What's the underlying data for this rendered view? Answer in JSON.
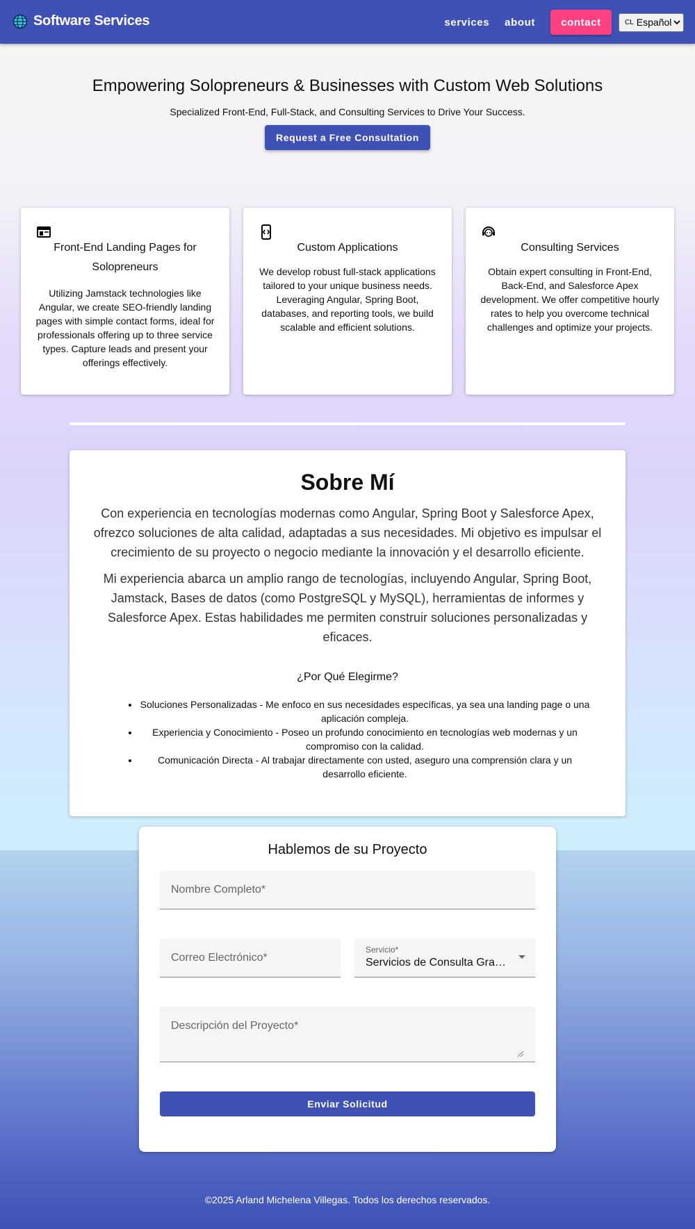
{
  "header": {
    "brand": "Software Services",
    "brand_icon": "globe-icon",
    "nav": {
      "services": "services",
      "about": "about",
      "contact": "contact"
    },
    "language": {
      "code": "CL",
      "selected": "Español"
    }
  },
  "hero": {
    "title": "Empowering Solopreneurs & Businesses with Custom Web Solutions",
    "subtitle": "Specialized Front-End, Full-Stack, and Consulting Services to Drive Your Success.",
    "cta": "Request a Free Consultation"
  },
  "services": [
    {
      "icon": "web-page-icon",
      "title": "Front-End Landing Pages for Solopreneurs",
      "text": "Utilizing Jamstack technologies like Angular, we create SEO-friendly landing pages with simple contact forms, ideal for professionals offering up to three service types. Capture leads and present your offerings effectively."
    },
    {
      "icon": "phone-code-icon",
      "title": "Custom Applications",
      "text": "We develop robust full-stack applications tailored to your unique business needs. Leveraging Angular, Spring Boot, databases, and reporting tools, we build scalable and efficient solutions."
    },
    {
      "icon": "support-agent-icon",
      "title": "Consulting Services",
      "text": "Obtain expert consulting in Front-End, Back-End, and Salesforce Apex development. We offer competitive hourly rates to help you overcome technical challenges and optimize your projects."
    }
  ],
  "about": {
    "title": "Sobre Mí",
    "p1": "Con experiencia en tecnologías modernas como Angular, Spring Boot y Salesforce Apex, ofrezco soluciones de alta calidad, adaptadas a sus necesidades. Mi objetivo es impulsar el crecimiento de su proyecto o negocio mediante la innovación y el desarrollo eficiente.",
    "p2": "Mi experiencia abarca un amplio rango de tecnologías, incluyendo Angular, Spring Boot, Jamstack, Bases de datos (como PostgreSQL y MySQL), herramientas de informes y Salesforce Apex. Estas habilidades me permiten construir soluciones personalizadas y eficaces.",
    "why_title": "¿Por Qué Elegirme?",
    "reasons": [
      "Soluciones Personalizadas - Me enfoco en sus necesidades específicas, ya sea una landing page o una aplicación compleja.",
      "Experiencia y Conocimiento - Poseo un profundo conocimiento en tecnologías web modernas y un compromiso con la calidad.",
      "Comunicación Directa - Al trabajar directamente con usted, aseguro una comprensión clara y un desarrollo eficiente."
    ]
  },
  "contact": {
    "title": "Hablemos de su Proyecto",
    "name_placeholder": "Nombre Completo*",
    "email_placeholder": "Correo Electrónico*",
    "service_label": "Servicio*",
    "service_value": "Servicios de Consulta Gratuitos",
    "description_placeholder": "Descripción del Proyecto*",
    "submit": "Enviar Solicitud"
  },
  "footer": {
    "text": "©2025 Arland Michelena Villegas. Todos los derechos reservados."
  },
  "colors": {
    "primary": "#3f51b5",
    "accent": "#ff4081",
    "background": "#f5f5f5"
  }
}
